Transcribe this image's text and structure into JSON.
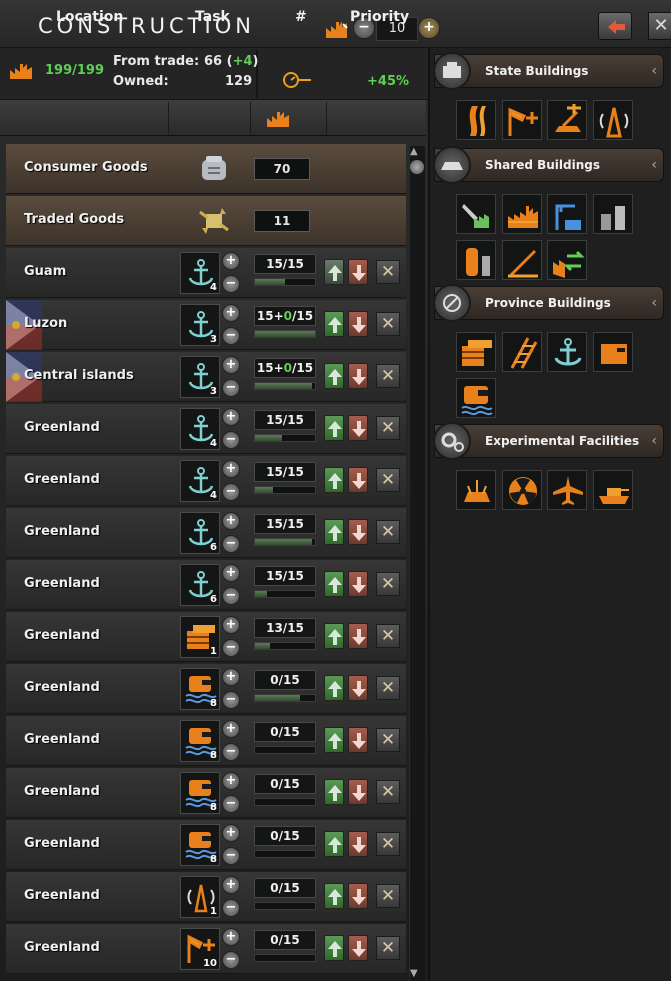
{
  "header": {
    "title": "Construction",
    "max_factories": "10"
  },
  "stats": {
    "factories": "199/199",
    "from_trade_label": "From trade:",
    "from_trade_value": "66 (+4)",
    "owned_label": "Owned:",
    "owned_value": "129",
    "speed_bonus": "+45%"
  },
  "columns": {
    "location": "Location",
    "task": "Task",
    "factories": "#",
    "priority": "Priority"
  },
  "goods": [
    {
      "name": "Consumer Goods",
      "value": "70",
      "icon": "consumer-goods-icon"
    },
    {
      "name": "Traded Goods",
      "value": "11",
      "icon": "traded-goods-icon"
    }
  ],
  "queue": [
    {
      "location": "Guam",
      "building": "naval-base-icon",
      "level": "4",
      "progress": "15/15",
      "fraction": 0.5,
      "flag": false,
      "up_enabled": false
    },
    {
      "location": "Luzon",
      "building": "naval-base-icon",
      "level": "3",
      "progress": "15+0/15",
      "fraction": 1.0,
      "flag": true,
      "up_enabled": true
    },
    {
      "location": "Central islands",
      "building": "naval-base-icon",
      "level": "3",
      "progress": "15+0/15",
      "fraction": 0.95,
      "flag": true,
      "up_enabled": true
    },
    {
      "location": "Greenland",
      "building": "naval-base-icon",
      "level": "4",
      "progress": "15/15",
      "fraction": 0.45,
      "flag": false,
      "up_enabled": true
    },
    {
      "location": "Greenland",
      "building": "naval-base-icon",
      "level": "4",
      "progress": "15/15",
      "fraction": 0.3,
      "flag": false,
      "up_enabled": true
    },
    {
      "location": "Greenland",
      "building": "naval-base-icon",
      "level": "6",
      "progress": "15/15",
      "fraction": 0.95,
      "flag": false,
      "up_enabled": true
    },
    {
      "location": "Greenland",
      "building": "naval-base-icon",
      "level": "6",
      "progress": "15/15",
      "fraction": 0.2,
      "flag": false,
      "up_enabled": true
    },
    {
      "location": "Greenland",
      "building": "supply-hub-icon",
      "level": "1",
      "progress": "13/15",
      "fraction": 0.25,
      "flag": false,
      "up_enabled": true
    },
    {
      "location": "Greenland",
      "building": "naval-headquarters-icon",
      "level": "8",
      "progress": "0/15",
      "fraction": 0.75,
      "flag": false,
      "up_enabled": true
    },
    {
      "location": "Greenland",
      "building": "naval-headquarters-icon",
      "level": "8",
      "progress": "0/15",
      "fraction": 0.0,
      "flag": false,
      "up_enabled": true
    },
    {
      "location": "Greenland",
      "building": "naval-headquarters-icon",
      "level": "8",
      "progress": "0/15",
      "fraction": 0.0,
      "flag": false,
      "up_enabled": true
    },
    {
      "location": "Greenland",
      "building": "naval-headquarters-icon",
      "level": "8",
      "progress": "0/15",
      "fraction": 0.0,
      "flag": false,
      "up_enabled": true
    },
    {
      "location": "Greenland",
      "building": "radar-station-icon",
      "level": "1",
      "progress": "0/15",
      "fraction": 0.0,
      "flag": false,
      "up_enabled": true
    },
    {
      "location": "Greenland",
      "building": "air-base-icon",
      "level": "10",
      "progress": "0/15",
      "fraction": 0.0,
      "flag": false,
      "up_enabled": true
    }
  ],
  "sections": {
    "state": "State Buildings",
    "shared": "Shared Buildings",
    "province": "Province Buildings",
    "experimental": "Experimental Facilities"
  },
  "colors": {
    "accent_orange": "#e8801c",
    "progress_green": "#5fcf55",
    "naval_teal": "#7fd0d0"
  }
}
